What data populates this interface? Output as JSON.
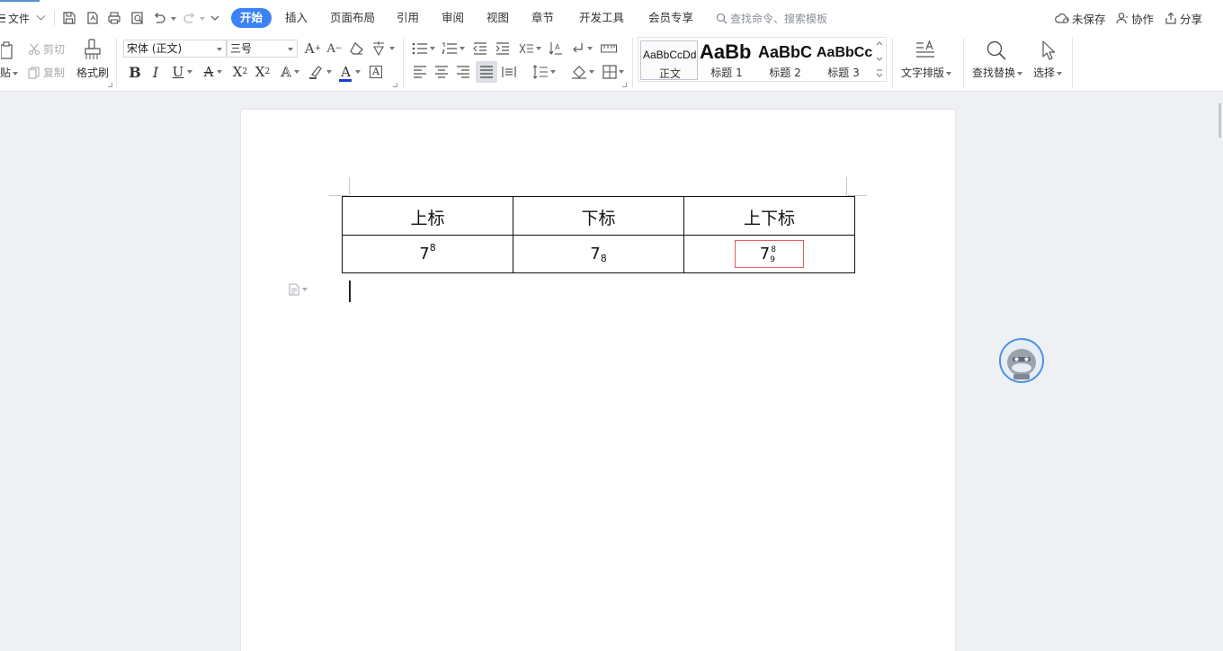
{
  "menubar": {
    "file_label": "文件",
    "tabs": [
      {
        "label": "开始",
        "active": true
      },
      {
        "label": "插入"
      },
      {
        "label": "页面布局"
      },
      {
        "label": "引用"
      },
      {
        "label": "审阅"
      },
      {
        "label": "视图"
      },
      {
        "label": "章节"
      },
      {
        "label": "开发工具"
      },
      {
        "label": "会员专享"
      }
    ],
    "search_placeholder": "查找命令、搜索模板",
    "unsaved_label": "未保存",
    "collab_label": "协作",
    "share_label": "分享"
  },
  "ribbon": {
    "paste_label": "贴",
    "cut_label": "剪切",
    "copy_label": "复制",
    "format_painter_label": "格式刷",
    "font_name": "宋体 (正文)",
    "font_size": "三号",
    "styles": [
      {
        "preview": "AaBbCcDd",
        "name": "正文",
        "selected": true
      },
      {
        "preview": "AaBb",
        "name": "标题 1"
      },
      {
        "preview": "AaBbC",
        "name": "标题 2"
      },
      {
        "preview": "AaBbCc",
        "name": "标题 3"
      }
    ],
    "text_layout_label": "文字排版",
    "find_replace_label": "查找替换",
    "select_label": "选择"
  },
  "document": {
    "table": {
      "headers": [
        "上标",
        "下标",
        "上下标"
      ],
      "row": {
        "superscript": {
          "base": "7",
          "sup": "8"
        },
        "subscript": {
          "base": "7",
          "sub": "8"
        },
        "both": {
          "base": "7",
          "sup": "8",
          "sub": "9"
        }
      }
    }
  },
  "colors": {
    "accent": "#3a82f6",
    "selection_box": "#e55a5a",
    "font_color_bar": "#1a3fd6"
  }
}
